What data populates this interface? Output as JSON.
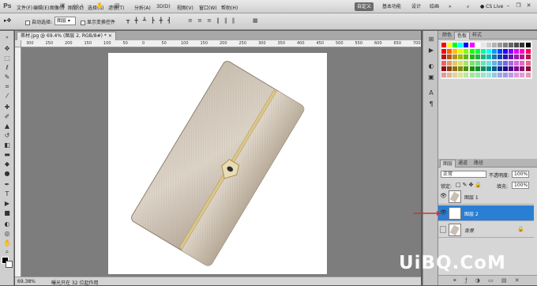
{
  "app": {
    "logo": "Ps"
  },
  "menubar": {
    "items": [
      "文件(F)",
      "编辑(E)",
      "图像(I)",
      "图层(L)",
      "选择(S)",
      "滤镜(T)",
      "分析(A)",
      "3D(D)",
      "视图(V)",
      "窗口(W)",
      "帮助(H)"
    ],
    "zoom_label": "66.4",
    "workspaces": [
      "自定义",
      "基本功能",
      "设计",
      "绘画"
    ],
    "active_workspace": "自定义",
    "cs_live": "CS Live"
  },
  "options": {
    "auto_select_label": "自动选择:",
    "auto_select_value": "图层",
    "show_transform_label": "显示变换控件"
  },
  "document": {
    "tab_title": "茶材.jpg @ 69.4% (图层 2, RGB/8#) *",
    "zoom": "69.38%",
    "status_info": "曝光只在 32 位起作用"
  },
  "ruler_ticks": [
    "300",
    "250",
    "200",
    "150",
    "100",
    "50",
    "0",
    "50",
    "100",
    "150",
    "200",
    "250",
    "300",
    "350",
    "400",
    "450",
    "500",
    "550",
    "600",
    "650",
    "700"
  ],
  "panels": {
    "top_tabs": [
      "颜色",
      "色板",
      "样式"
    ],
    "active_top_tab": "色板",
    "layer_tabs": [
      "图层",
      "通道",
      "路径"
    ],
    "active_layer_tab": "图层",
    "blend_mode": "正常",
    "opacity_label": "不透明度:",
    "opacity_value": "100%",
    "lock_label": "锁定:",
    "fill_label": "填充:",
    "fill_value": "100%",
    "layers": [
      {
        "name": "图层 1",
        "visible": true,
        "selected": false
      },
      {
        "name": "图层 2",
        "visible": true,
        "selected": true
      },
      {
        "name": "背景",
        "visible": false,
        "selected": false,
        "locked": true
      }
    ]
  },
  "watermark": "UiBQ.CoM",
  "colors": {
    "selection": "#2a7fd4",
    "arrow": "#c23a3a",
    "wallet_light": "#d4cabc",
    "wallet_dark": "#a39684",
    "trim": "#d9c58d"
  }
}
